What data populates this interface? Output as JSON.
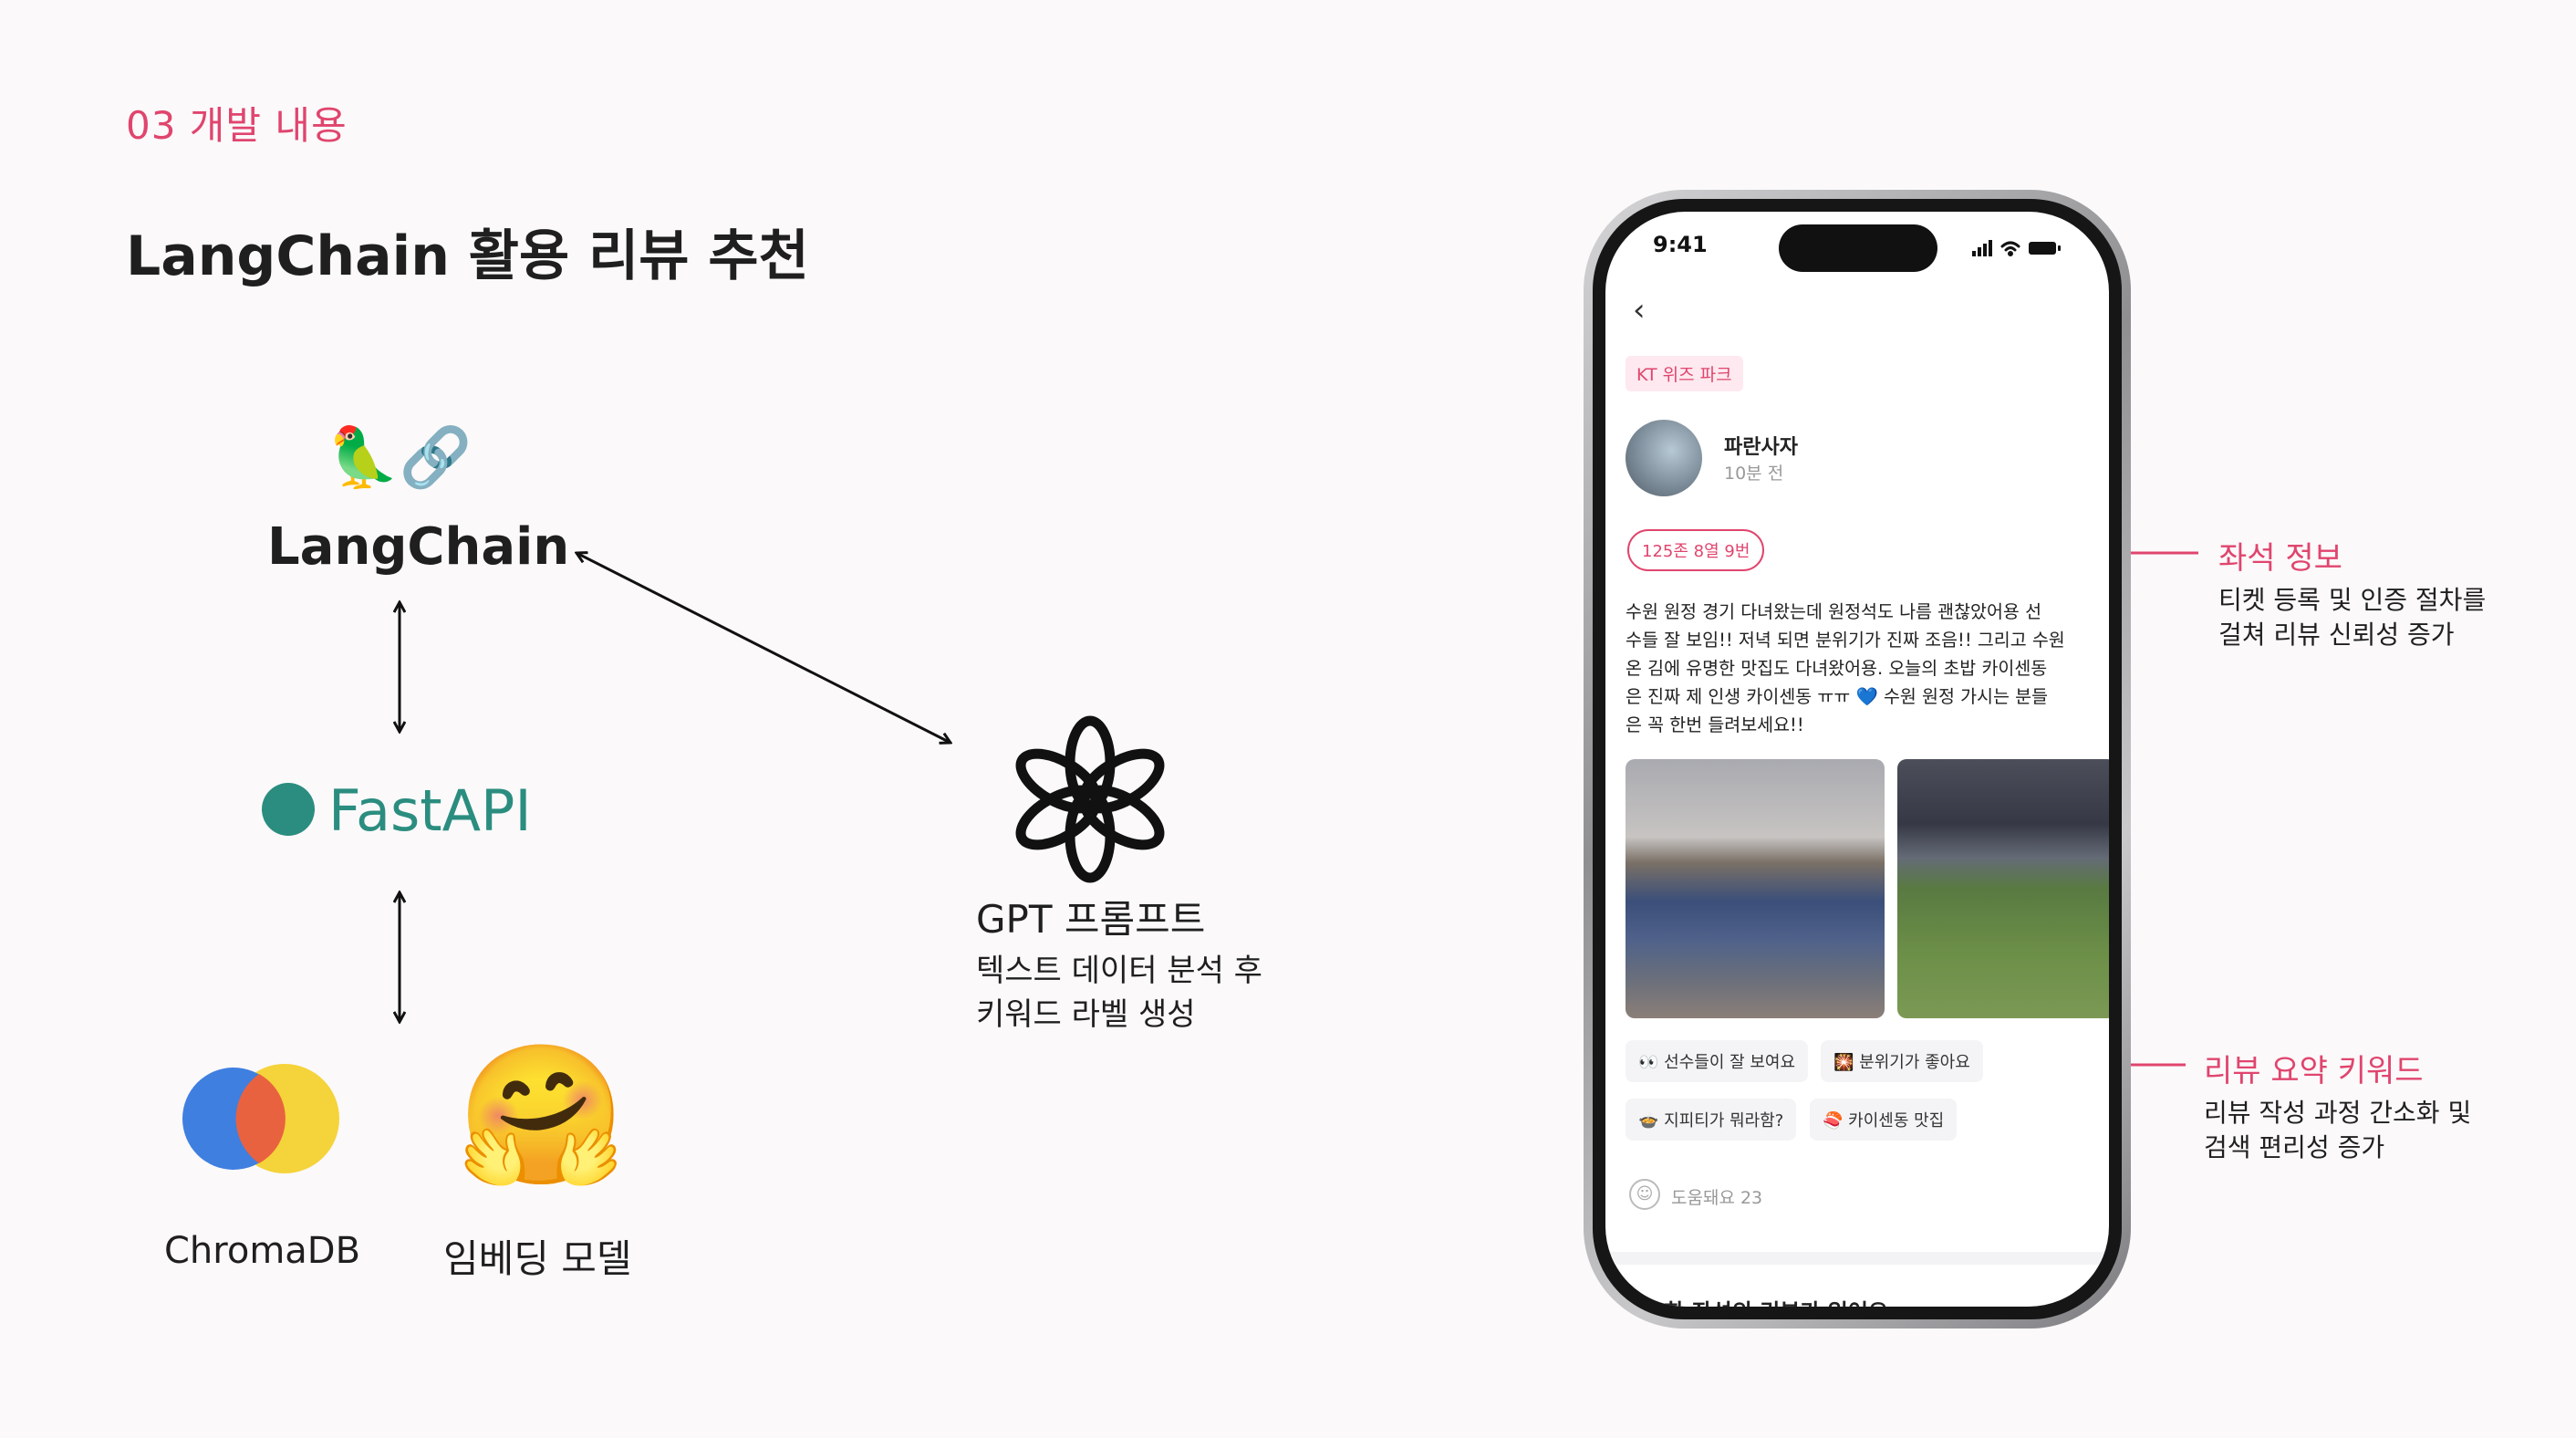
{
  "slide": {
    "section_label": "03 개발 내용",
    "title": "LangChain 활용 리뷰 추천"
  },
  "diagram": {
    "langchain": {
      "emoji": "🦜🔗",
      "label": "LangChain"
    },
    "fastapi": {
      "label": "FastAPI"
    },
    "gpt": {
      "title": "GPT 프롬프트",
      "description_lines": [
        "텍스트 데이터 분석 후",
        "키워드 라벨 생성"
      ]
    },
    "chromadb": {
      "label": "ChromaDB"
    },
    "embedding": {
      "emoji": "🤗",
      "label": "임베딩 모델"
    }
  },
  "phone": {
    "status_time": "9:41",
    "venue_tag": "KT 위즈 파크",
    "author": {
      "name": "파란사자",
      "time": "10분 전"
    },
    "seat_tag": "125존 8열 9번",
    "review_lines": [
      "수원 원정 경기 다녀왔는데 원정석도 나름 괜찮았어용 선",
      "수들 잘 보임!! 저녁 되면 분위기가 진짜 조음!! 그리고 수원",
      "온 김에 유명한 맛집도 다녀왔어용. 오늘의 초밥 카이센동",
      "은 진짜 제 인생 카이센동 ㅠㅠ 💙 수원 원정 가시는 분들",
      "은 꼭 한번 들려보세요!!"
    ],
    "keyword_chips": [
      "👀 선수들이 잘 보여요",
      "🎇 분위기가 좋아요",
      "🍲 지피티가 뭐라함?",
      "🍣 카이센동 맛집"
    ],
    "helpful_text": "도움돼요 23",
    "next_section": "비슷한 좌석의 리뷰가 있어요"
  },
  "callouts": {
    "seat": {
      "title": "좌석 정보",
      "description_lines": [
        "티켓 등록 및 인증 절차를",
        "걸쳐 리뷰 신뢰성 증가"
      ]
    },
    "keywords": {
      "title": "리뷰 요약 키워드",
      "description_lines": [
        "리뷰 작성 과정 간소화 및",
        "검색 편리성 증가"
      ]
    }
  },
  "colors": {
    "accent": "#e0456e",
    "fastapi": "#2b8d7f",
    "background": "#fbf9fa"
  }
}
